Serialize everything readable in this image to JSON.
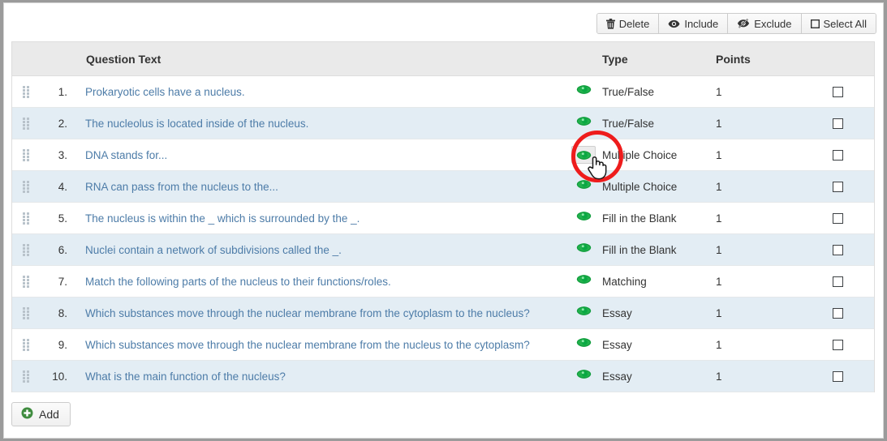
{
  "toolbar": {
    "buttons": [
      {
        "label": "Delete",
        "icon": "trash-icon"
      },
      {
        "label": "Include",
        "icon": "eye-icon"
      },
      {
        "label": "Exclude",
        "icon": "eye-slash-icon"
      },
      {
        "label": "Select All",
        "icon": "checkbox-icon"
      }
    ]
  },
  "table": {
    "columns": {
      "handle": "",
      "number": "",
      "question_text": "Question Text",
      "preview": "",
      "type": "Type",
      "points": "Points",
      "select": ""
    },
    "rows": [
      {
        "num": "1.",
        "text": "Prokaryotic cells have a nucleus.",
        "type": "True/False",
        "points": "1"
      },
      {
        "num": "2.",
        "text": "The nucleolus is located inside of the nucleus.",
        "type": "True/False",
        "points": "1"
      },
      {
        "num": "3.",
        "text": "DNA stands for...",
        "type": "Multiple Choice",
        "points": "1"
      },
      {
        "num": "4.",
        "text": "RNA can pass from the nucleus to the...",
        "type": "Multiple Choice",
        "points": "1"
      },
      {
        "num": "5.",
        "text": "The nucleus is within the _ which is surrounded by the _.",
        "type": "Fill in the Blank",
        "points": "1"
      },
      {
        "num": "6.",
        "text": "Nuclei contain a network of subdivisions called the _.",
        "type": "Fill in the Blank",
        "points": "1"
      },
      {
        "num": "7.",
        "text": "Match the following parts of the nucleus to their functions/roles.",
        "type": "Matching",
        "points": "1"
      },
      {
        "num": "8.",
        "text": "Which substances move through the nuclear membrane from the cytoplasm to the nucleus?",
        "type": "Essay",
        "points": "1"
      },
      {
        "num": "9.",
        "text": "Which substances move through the nuclear membrane from the nucleus to the cytoplasm?",
        "type": "Essay",
        "points": "1"
      },
      {
        "num": "10.",
        "text": "What is the main function of the nucleus?",
        "type": "Essay",
        "points": "1"
      }
    ]
  },
  "footer": {
    "add_label": "Add",
    "add_icon": "plus-circle-icon"
  },
  "annotation": {
    "shape": "red-ellipse-highlight",
    "target_row": "3",
    "cursor": "pointing-hand-cursor"
  },
  "colors": {
    "link": "#4d7ca8",
    "alt_row": "#e3edf4",
    "header_bg": "#eaeaea",
    "eye_green": "#22b14c",
    "annotation_red": "#ee1c1c",
    "add_green": "#3f8c3f"
  }
}
